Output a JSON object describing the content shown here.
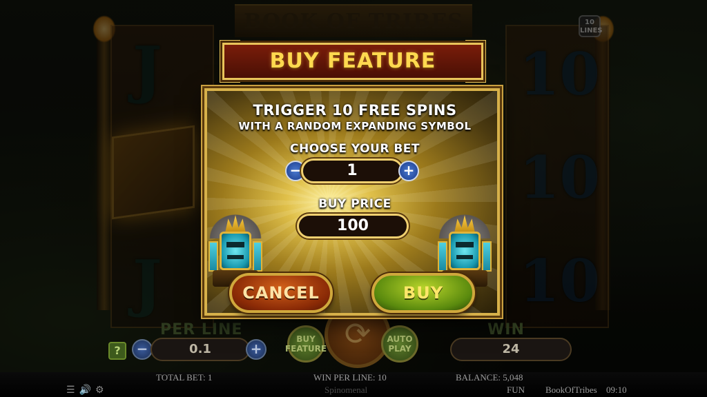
{
  "background": {
    "game_title": "BOOK OF TRIBES",
    "lines_badge": "10 LINES",
    "reel_symbols": [
      "J",
      "J",
      "10",
      "10",
      "10"
    ]
  },
  "modal": {
    "title": "BUY FEATURE",
    "trigger_line1": "TRIGGER 10 FREE SPINS",
    "trigger_line2": "WITH A RANDOM EXPANDING SYMBOL",
    "choose_bet_label": "CHOOSE YOUR BET",
    "bet_value": "1",
    "bet_minus": "−",
    "bet_plus": "+",
    "buy_price_label": "BUY PRICE",
    "buy_price_value": "100",
    "cancel_label": "CANCEL",
    "buy_label": "BUY"
  },
  "controls": {
    "help": "?",
    "per_line_label": "PER LINE",
    "per_line_value": "0.1",
    "minus": "−",
    "plus": "+",
    "buy_feature_label": "BUY FEATURE",
    "autoplay_label": "AUTO PLAY",
    "spin_glyph": "⟳",
    "win_label": "WIN",
    "win_value": "24"
  },
  "status_bar": {
    "total_bet": "TOTAL BET: 1",
    "win_per_line": "WIN PER LINE: 10",
    "balance": "BALANCE: 5,048",
    "mode": "FUN",
    "game_id": "BookOfTribes",
    "time": "09:10",
    "provider": "Spinomenal",
    "icons": [
      "menu-icon",
      "sound-icon",
      "settings-icon"
    ]
  },
  "colors": {
    "title_gold": "#ffd94f",
    "cancel_orange": "#c8561a",
    "buy_green": "#8ab41e",
    "value_box_bg": "#1c0f07",
    "stepper_blue": "#2a5ab0"
  }
}
